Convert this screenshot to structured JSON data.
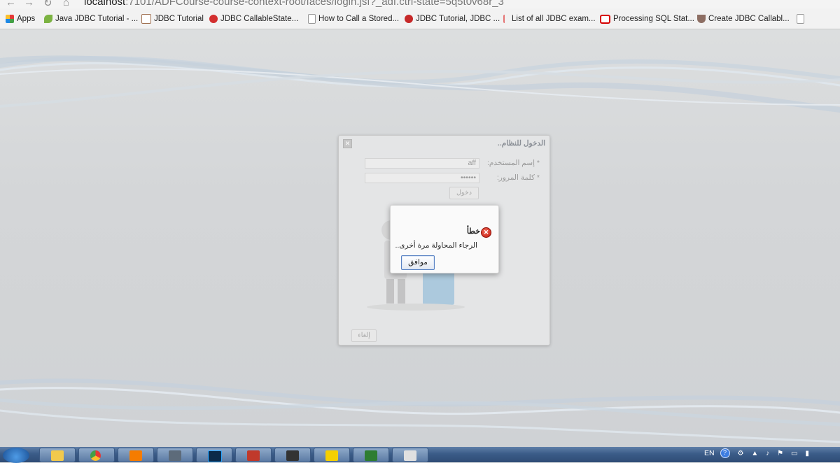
{
  "browser": {
    "url_host": "localhost",
    "url_rest": ":7101/ADFCourse-course-context-root/faces/login.jsf?_adf.ctrl-state=5q5t0v68r_3",
    "bookmarks": [
      {
        "label": "Apps",
        "color": "#d44"
      },
      {
        "label": "Java JDBC Tutorial - ...",
        "color": "#7cb342"
      },
      {
        "label": "JDBC Tutorial",
        "color": "#a07050"
      },
      {
        "label": "JDBC CallableState...",
        "color": "#d32f2f"
      },
      {
        "label": "How to Call a Stored...",
        "color": "#ffffff"
      },
      {
        "label": "JDBC Tutorial, JDBC ...",
        "color": "#c62828"
      },
      {
        "label": "List of all JDBC exam...",
        "color": "#e57373"
      },
      {
        "label": "Processing SQL Stat...",
        "color": "#d50000"
      },
      {
        "label": "Create JDBC Callabl...",
        "color": "#8d6e63"
      }
    ]
  },
  "login": {
    "title": "الدخول للنظام..",
    "username_label": "* إسم المستخدم:",
    "username_value": "aff",
    "password_label": "* كلمة المرور:",
    "password_value": "••••••",
    "login_button": "دخول",
    "cancel_button": "إلغاء"
  },
  "dialog": {
    "title": "خطأ",
    "message": "الرجاء المحاولة مرة أخرى..",
    "ok_button": "موافق",
    "error_color": "#d0190c"
  },
  "taskbar": {
    "language": "EN"
  }
}
